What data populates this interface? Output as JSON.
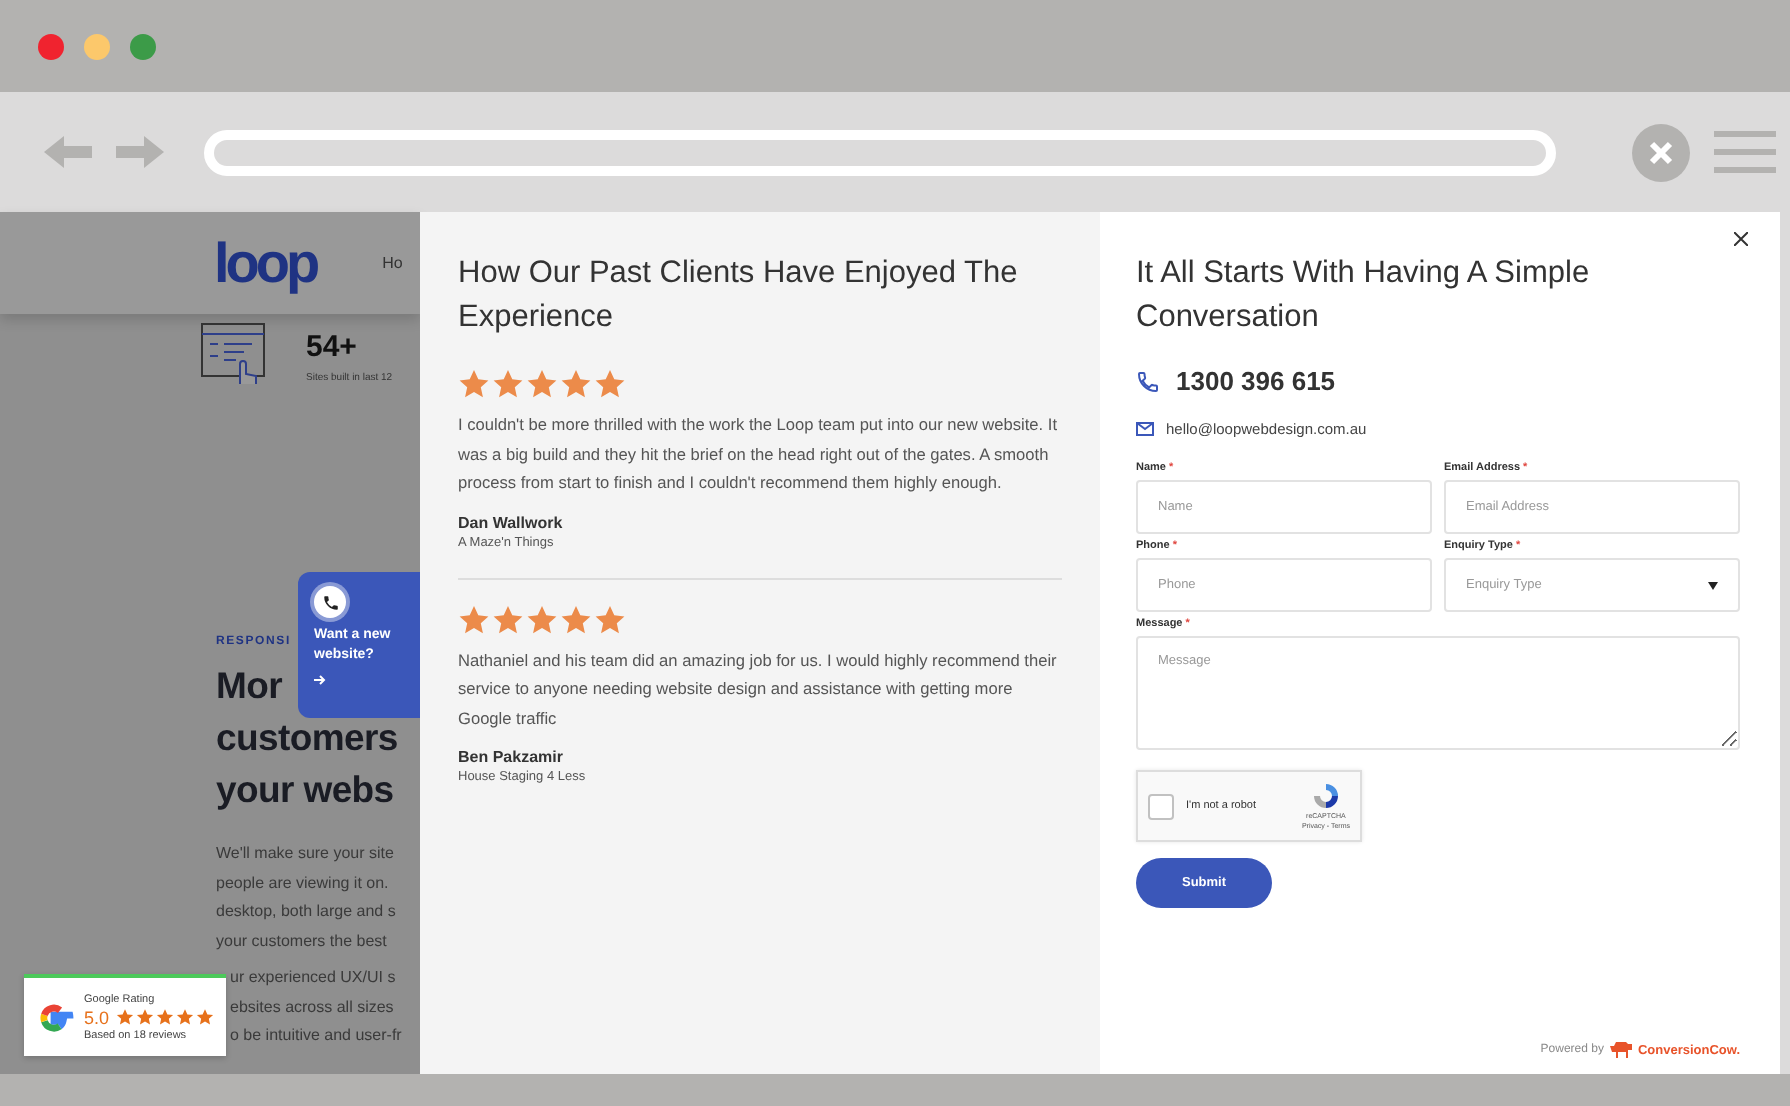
{
  "background_page": {
    "logo": "loop",
    "nav_item": "Ho",
    "stat": {
      "value": "54+",
      "label": "Sites built in last 12"
    },
    "eyebrow": "RESPONSI",
    "headline_lines": [
      "Mor",
      "customers",
      "your webs"
    ],
    "paragraph_lines": [
      "We'll make sure your site",
      "people are viewing it on.",
      "desktop, both large and s",
      "your customers the best"
    ],
    "paragraph2_lines": [
      "ur experienced UX/UI s",
      "ebsites across all sizes",
      "o be intuitive and user-fr"
    ]
  },
  "widget": {
    "lines": [
      "Want a new",
      "website?"
    ]
  },
  "google_badge": {
    "title": "Google Rating",
    "score": "5.0",
    "stars": 5,
    "reviews": "Based on 18 reviews"
  },
  "testimonials": {
    "title": "How Our Past Clients Have Enjoyed The Experience",
    "reviews": [
      {
        "stars": 5,
        "text": "I couldn't be more thrilled with the work the Loop team put into our new website. It was a big build and they hit the brief on the head right out of the gates. A smooth process from start to finish and I couldn't recommend them highly enough.",
        "name": "Dan Wallwork",
        "company": "A Maze'n Things"
      },
      {
        "stars": 5,
        "text": "Nathaniel and his team did an amazing job for us. I would highly recommend their service to anyone needing website design and assistance with getting more Google traffic",
        "name": "Ben Pakzamir",
        "company": "House Staging 4 Less"
      }
    ]
  },
  "contact": {
    "title": "It All Starts With Having A Simple Conversation",
    "phone": "1300 396 615",
    "email": "hello@loopwebdesign.com.au",
    "fields": [
      {
        "kind": "input",
        "label": "Name",
        "required_mark": "*",
        "placeholder": "Name"
      },
      {
        "kind": "input",
        "label": "Email Address",
        "required_mark": "*",
        "placeholder": "Email Address"
      },
      {
        "kind": "input",
        "label": "Phone",
        "required_mark": "*",
        "placeholder": "Phone"
      },
      {
        "kind": "select",
        "label": "Enquiry Type",
        "required_mark": "*",
        "placeholder": "Enquiry Type"
      },
      {
        "kind": "textarea",
        "label": "Message",
        "required_mark": "*",
        "placeholder": "Message"
      }
    ],
    "captcha": {
      "label": "I'm not a robot",
      "checked": false,
      "brand": "reCAPTCHA",
      "links": "Privacy - Terms"
    },
    "submit": "Submit",
    "powered_by": {
      "prefix": "Powered by",
      "brand": "ConversionCow."
    }
  }
}
